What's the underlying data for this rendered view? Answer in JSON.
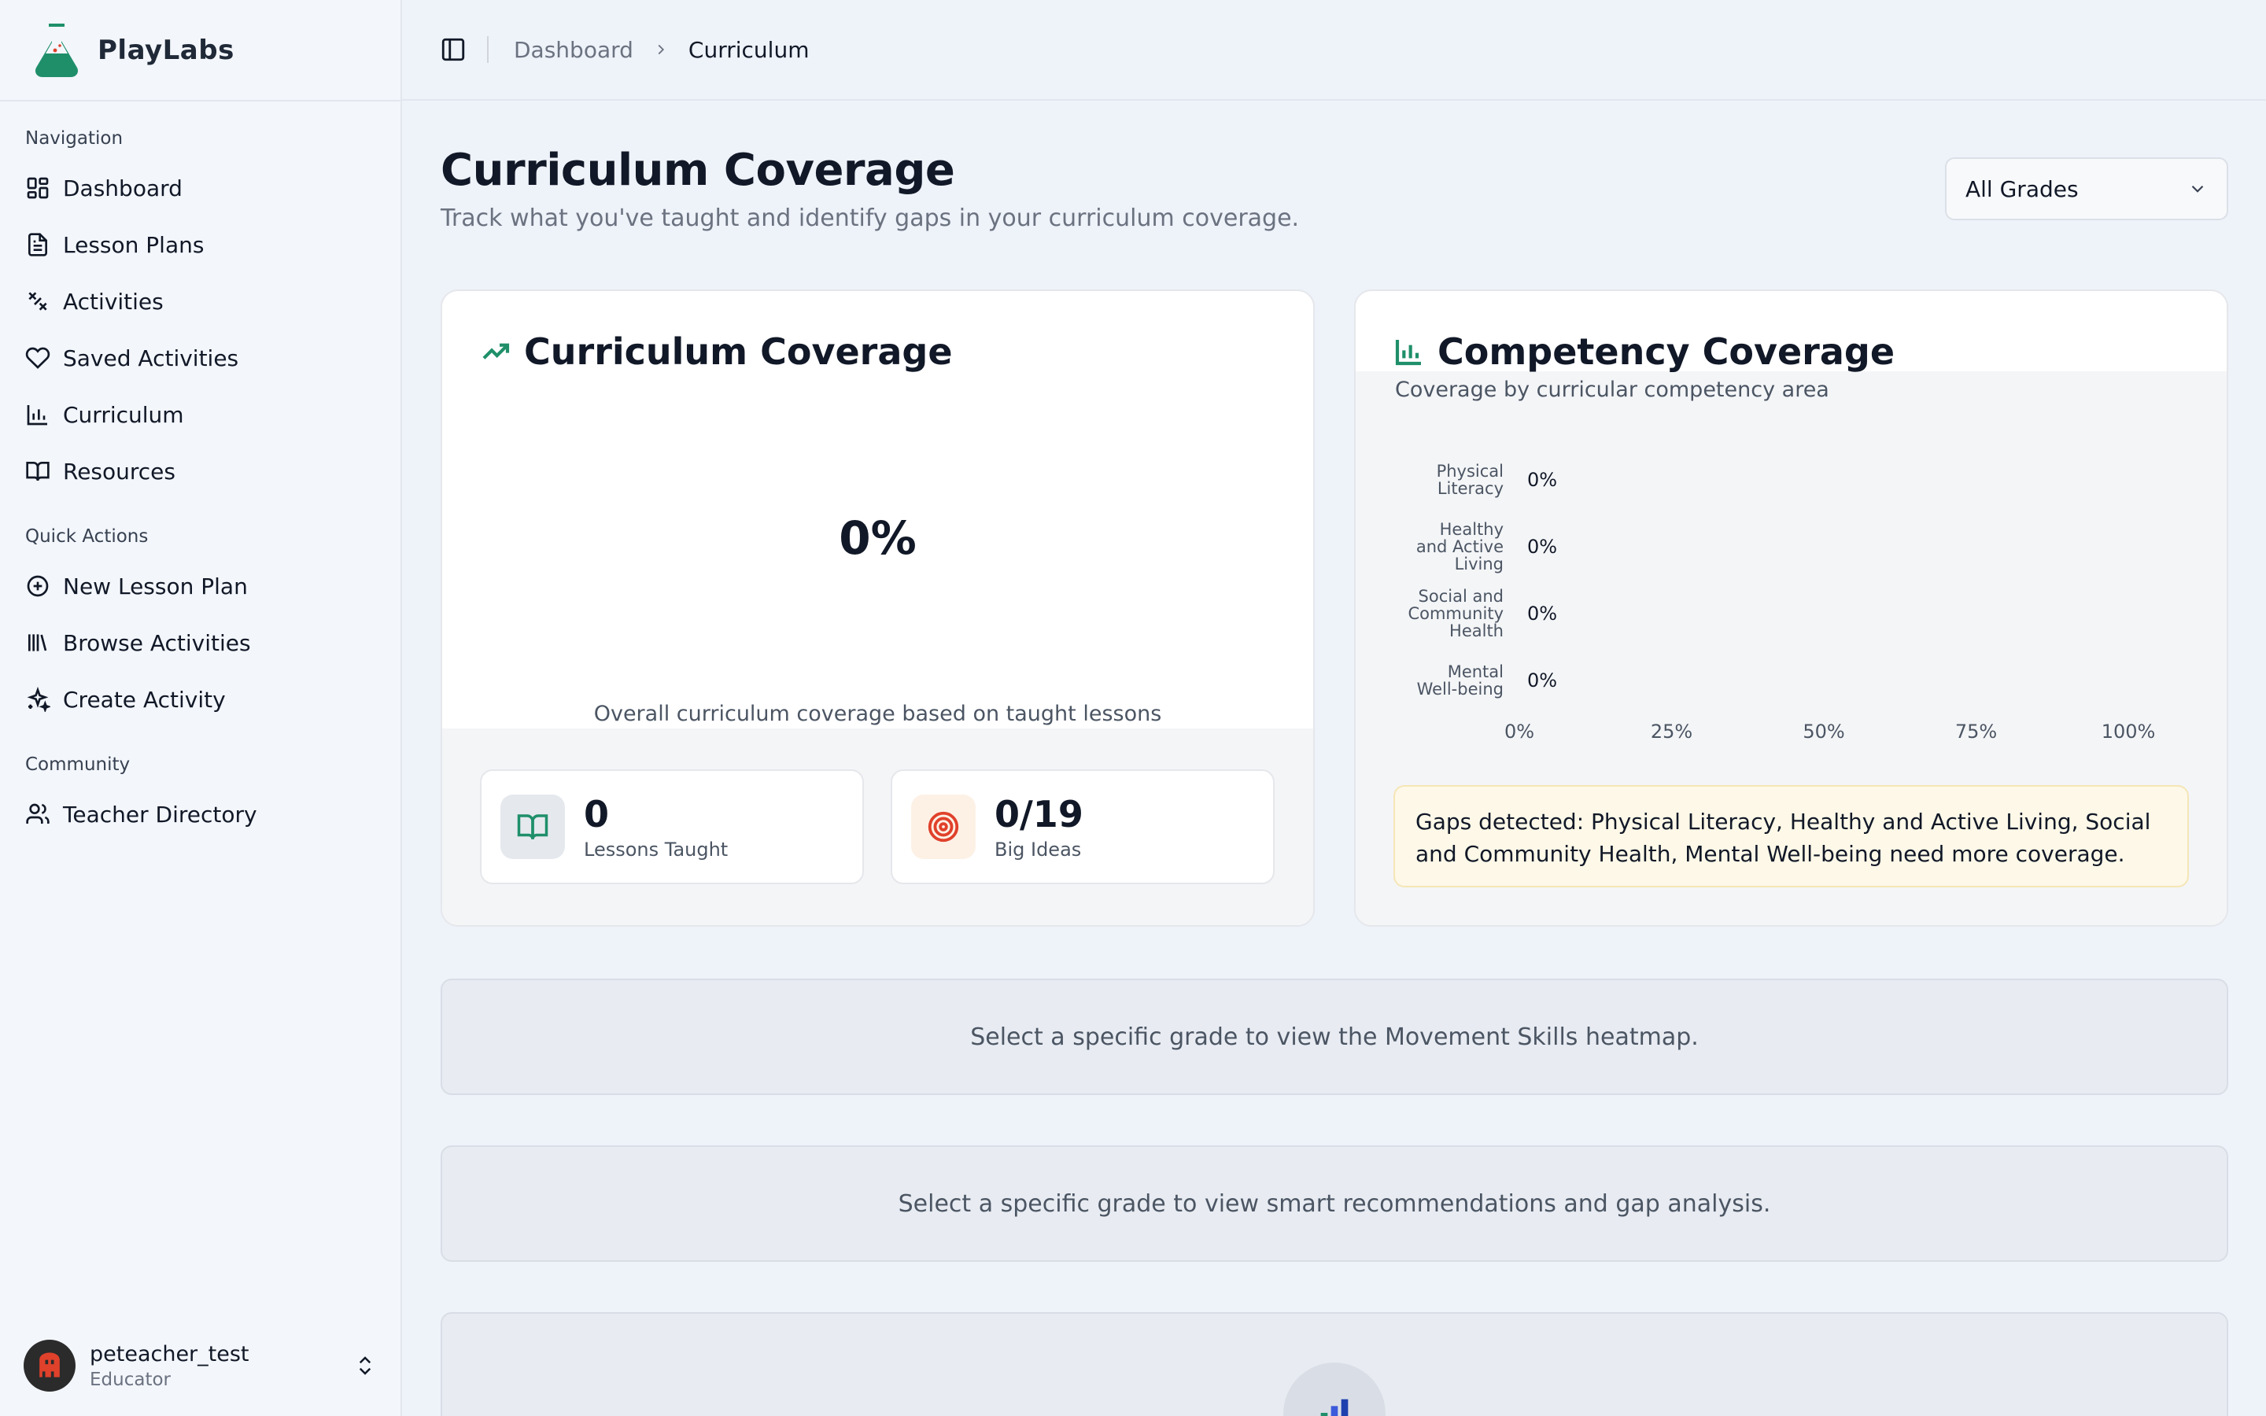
{
  "app": {
    "name": "PlayLabs"
  },
  "sidebar": {
    "sections": [
      {
        "heading": "Navigation",
        "items": [
          {
            "label": "Dashboard",
            "icon": "dashboard-icon"
          },
          {
            "label": "Lesson Plans",
            "icon": "document-icon"
          },
          {
            "label": "Activities",
            "icon": "activities-icon"
          },
          {
            "label": "Saved Activities",
            "icon": "heart-icon"
          },
          {
            "label": "Curriculum",
            "icon": "bar-chart-icon"
          },
          {
            "label": "Resources",
            "icon": "book-icon"
          }
        ]
      },
      {
        "heading": "Quick Actions",
        "items": [
          {
            "label": "New Lesson Plan",
            "icon": "plus-circle-icon"
          },
          {
            "label": "Browse Activities",
            "icon": "library-icon"
          },
          {
            "label": "Create Activity",
            "icon": "sparkles-icon"
          }
        ]
      },
      {
        "heading": "Community",
        "items": [
          {
            "label": "Teacher Directory",
            "icon": "users-icon"
          }
        ]
      }
    ],
    "user": {
      "name": "peteacher_test",
      "role": "Educator"
    }
  },
  "breadcrumb": {
    "parent": "Dashboard",
    "current": "Curriculum"
  },
  "page": {
    "title": "Curriculum Coverage",
    "subtitle": "Track what you've taught and identify gaps in your curriculum coverage.",
    "grade_filter": {
      "selected": "All Grades"
    }
  },
  "coverage_card": {
    "title": "Curriculum Coverage",
    "percent": "0%",
    "caption": "Overall curriculum coverage based on taught lessons",
    "stats": [
      {
        "value": "0",
        "label": "Lessons Taught"
      },
      {
        "value": "0/19",
        "label": "Big Ideas"
      }
    ]
  },
  "competency_card": {
    "title": "Competency Coverage",
    "subtitle": "Coverage by curricular competency area",
    "gaps_alert": "Gaps detected: Physical Literacy, Healthy and Active Living, Social and Community Health, Mental Well-being need more coverage."
  },
  "chart_data": {
    "type": "bar",
    "orientation": "horizontal",
    "categories": [
      "Physical Literacy",
      "Healthy and Active Living",
      "Social and Community Health",
      "Mental Well-being"
    ],
    "category_lines": [
      [
        "Physical",
        "Literacy"
      ],
      [
        "Healthy",
        "and Active",
        "Living"
      ],
      [
        "Social and",
        "Community",
        "Health"
      ],
      [
        "Mental",
        "Well-being"
      ]
    ],
    "values": [
      0,
      0,
      0,
      0
    ],
    "value_labels": [
      "0%",
      "0%",
      "0%",
      "0%"
    ],
    "xlim": [
      0,
      100
    ],
    "x_ticks": [
      "0%",
      "25%",
      "50%",
      "75%",
      "100%"
    ],
    "grid": false,
    "bar_color": "#1f8f6a"
  },
  "panels": {
    "heatmap_notice": "Select a specific grade to view the Movement Skills heatmap.",
    "recommendations_notice": "Select a specific grade to view smart recommendations and gap analysis."
  },
  "colors": {
    "accent": "#1f8f6a",
    "target": "#e0412b",
    "alert_bg": "#fdf8e8"
  }
}
